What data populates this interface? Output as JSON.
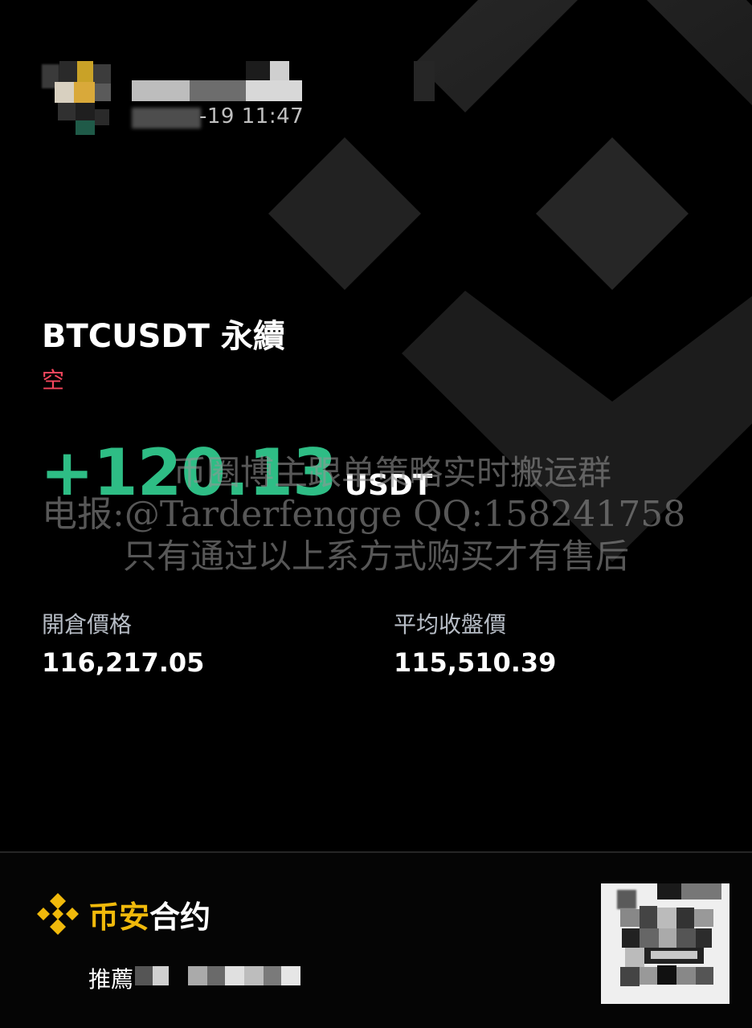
{
  "header": {
    "timestamp": "-19 11:47"
  },
  "position": {
    "symbol": "BTCUSDT 永續",
    "side": "空",
    "pnl_value": "+120.13",
    "pnl_unit": "USDT"
  },
  "watermark": {
    "line1": "币圈博主跟单策略实时搬运群",
    "line2": "电报:@Tarderfengge QQ:158241758",
    "line3": "只有通过以上系方式购买才有售后"
  },
  "prices": {
    "entry_label": "開倉價格",
    "entry_value": "116,217.05",
    "avg_close_label": "平均收盤價",
    "avg_close_value": "115,510.39"
  },
  "footer": {
    "brand_prefix": "币安",
    "brand_suffix": "合约",
    "referral_label": "推薦"
  },
  "colors": {
    "background": "#000000",
    "profit_green": "#2ebd85",
    "short_red": "#f6465d",
    "brand_gold": "#f0b90b"
  },
  "icons": {
    "background_logo": "binance-logo-icon",
    "brand_logo": "binance-logo-icon"
  }
}
